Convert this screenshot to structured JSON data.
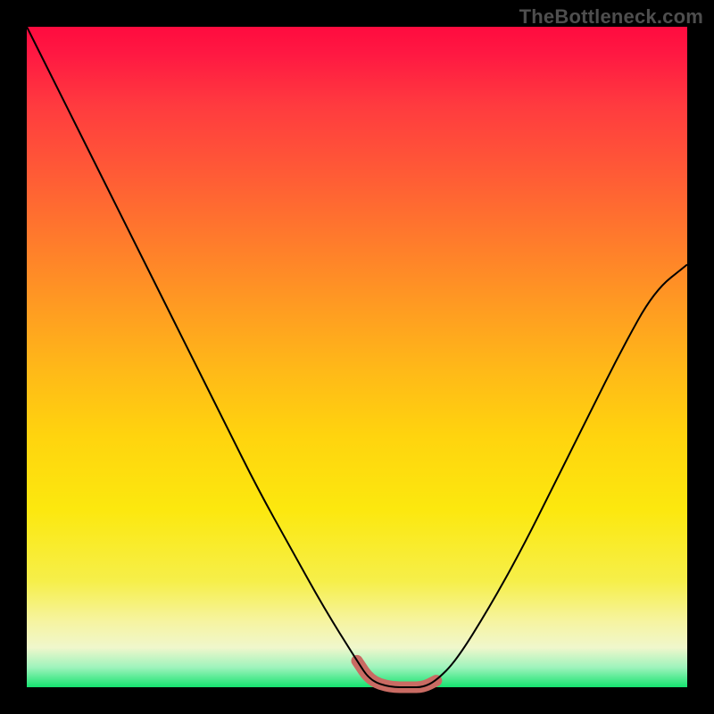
{
  "watermark": "TheBottleneck.com",
  "chart_data": {
    "type": "line",
    "title": "",
    "xlabel": "",
    "ylabel": "",
    "xlim": [
      0,
      100
    ],
    "ylim": [
      0,
      100
    ],
    "series": [
      {
        "name": "bottleneck-curve",
        "x": [
          0,
          5,
          10,
          15,
          20,
          25,
          30,
          35,
          40,
          45,
          50,
          52,
          55,
          58,
          60,
          62,
          65,
          70,
          75,
          80,
          85,
          90,
          95,
          100
        ],
        "values": [
          100,
          90,
          80,
          70,
          60,
          50,
          40,
          30,
          21,
          12,
          4,
          1,
          0,
          0,
          0,
          1,
          4,
          12,
          21,
          31,
          41,
          51,
          60,
          64
        ]
      }
    ],
    "highlight_segment": {
      "x": [
        50,
        52,
        55,
        58,
        60,
        62
      ],
      "values": [
        4,
        1,
        0,
        0,
        0,
        1
      ]
    },
    "gradient_stops": [
      {
        "pos": 0,
        "color": "#ff0b3f"
      },
      {
        "pos": 50,
        "color": "#ffba18"
      },
      {
        "pos": 90,
        "color": "#f6f4a0"
      },
      {
        "pos": 100,
        "color": "#15e36f"
      }
    ]
  }
}
